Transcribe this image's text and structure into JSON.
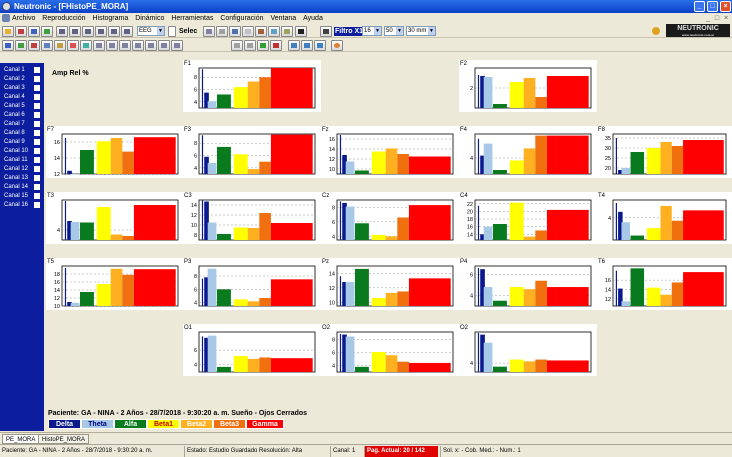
{
  "window": {
    "title": "Neutronic - [FHistoPE_MORA]",
    "minimize": "_",
    "maximize": "□",
    "close": "×"
  },
  "menu": [
    "Archivo",
    "Reproducción",
    "Histograma",
    "Dinámico",
    "Herramientas",
    "Configuración",
    "Ventana",
    "Ayuda"
  ],
  "toolbar": {
    "mode": "EEG",
    "selec_label": "Selec",
    "filter_label": "Filtro X1",
    "filter_value": "16",
    "speed_value": "50",
    "speed_unit": "30 mm",
    "brand": "NEUTRONIC",
    "brand_url": "www.neutronic.com.ar"
  },
  "channels": [
    "Canal 1",
    "Canal 2",
    "Canal 3",
    "Canal 4",
    "Canal 5",
    "Canal 6",
    "Canal 7",
    "Canal 8",
    "Canal 9",
    "Canal 10",
    "Canal 11",
    "Canal 12",
    "Canal 13",
    "Canal 14",
    "Canal 15",
    "Canal 16"
  ],
  "amp_title": "Amp Rel %",
  "patient": "Paciente: GA - NINA - 2 Años - 28/7/2018 - 9:30:20 a. m.  Sueño - Ojos Cerrados",
  "bands": [
    {
      "name": "Delta",
      "color": "#0a1a8c",
      "text": "#ffffff"
    },
    {
      "name": "Theta",
      "color": "#a8c8e8",
      "text": "#000080"
    },
    {
      "name": "Alfa",
      "color": "#0a7a1e",
      "text": "#ffffff"
    },
    {
      "name": "Beta1",
      "color": "#ffff00",
      "text": "#c00000"
    },
    {
      "name": "Beta2",
      "color": "#ffb020",
      "text": "#ffffff"
    },
    {
      "name": "Beta3",
      "color": "#f07010",
      "text": "#ffffff"
    },
    {
      "name": "Gamma",
      "color": "#ff0000",
      "text": "#ffffff"
    }
  ],
  "charts": [
    {
      "label": "F1",
      "ticks": [
        "8",
        "6",
        "4"
      ],
      "ylim": [
        3,
        9.5
      ],
      "values": [
        5.5,
        4.1,
        5.2,
        6.4,
        7.3,
        8.0,
        9.5
      ],
      "band0_line": 9.3
    },
    {
      "label": "F2",
      "ticks": [
        "2"
      ],
      "ylim": [
        0,
        4
      ],
      "values": [
        3.2,
        3.1,
        0.4,
        2.6,
        3.0,
        1.1,
        3.2
      ],
      "band0_line": 3.3
    },
    {
      "label": "F7",
      "ticks": [
        "16",
        "14",
        "12"
      ],
      "ylim": [
        12,
        17
      ],
      "values": [
        12.4,
        12.0,
        15.0,
        16.1,
        16.5,
        14.8,
        16.6
      ],
      "band0_line": 16.5
    },
    {
      "label": "F3",
      "ticks": [
        "8",
        "6",
        "4"
      ],
      "ylim": [
        3,
        9.5
      ],
      "values": [
        5.8,
        4.8,
        7.4,
        6.2,
        3.8,
        5.0,
        9.4
      ],
      "band0_line": 9.3
    },
    {
      "label": "Fz",
      "ticks": [
        "16",
        "14",
        "12",
        "10"
      ],
      "ylim": [
        9,
        17
      ],
      "values": [
        12.8,
        11.5,
        9.7,
        13.5,
        14.1,
        13.0,
        12.5
      ],
      "band0_line": 16.8
    },
    {
      "label": "F4",
      "ticks": [
        "4"
      ],
      "ylim": [
        2,
        7
      ],
      "values": [
        4.3,
        5.8,
        2.5,
        3.7,
        5.2,
        6.8,
        6.8
      ],
      "band0_line": 6.4
    },
    {
      "label": "F8",
      "ticks": [
        "35",
        "30",
        "25",
        "20"
      ],
      "ylim": [
        17,
        37
      ],
      "values": [
        19,
        20,
        28,
        30,
        33,
        31,
        34
      ],
      "band0_line": 35
    },
    {
      "label": "T3",
      "ticks": [
        "4"
      ],
      "ylim": [
        2,
        10
      ],
      "values": [
        5.8,
        5.6,
        5.5,
        8.6,
        3.1,
        2.8,
        9.0
      ],
      "band0_line": 9.8
    },
    {
      "label": "C3",
      "ticks": [
        "14",
        "12",
        "10",
        "8"
      ],
      "ylim": [
        7,
        15
      ],
      "values": [
        14.7,
        10.5,
        8.2,
        9.5,
        9.4,
        12.4,
        10.4
      ],
      "band0_line": 14.9
    },
    {
      "label": "Cz",
      "ticks": [
        "8",
        "6",
        "4"
      ],
      "ylim": [
        3.5,
        9
      ],
      "values": [
        8.6,
        8.1,
        5.8,
        4.2,
        4.0,
        6.6,
        8.3
      ],
      "band0_line": 8.8
    },
    {
      "label": "C4",
      "ticks": [
        "22",
        "20",
        "18",
        "16",
        "14"
      ],
      "ylim": [
        12.5,
        23
      ],
      "values": [
        14.0,
        16.0,
        16.7,
        22.3,
        13.4,
        15.0,
        20.4
      ],
      "band0_line": 21.5
    },
    {
      "label": "T4",
      "ticks": [
        "4"
      ],
      "ylim": [
        2.5,
        5.2
      ],
      "values": [
        4.4,
        3.7,
        2.8,
        3.3,
        4.8,
        3.8,
        4.5
      ],
      "band0_line": 5.0
    },
    {
      "label": "T5",
      "ticks": [
        "18",
        "16",
        "14",
        "12",
        "10"
      ],
      "ylim": [
        10,
        20
      ],
      "values": [
        11,
        10.8,
        13.5,
        15.5,
        19.3,
        17.8,
        19.2
      ],
      "band0_line": 19.5
    },
    {
      "label": "P3",
      "ticks": [
        "8",
        "6",
        "4"
      ],
      "ylim": [
        3.5,
        9.5
      ],
      "values": [
        7.8,
        9.1,
        6.0,
        4.5,
        4.2,
        4.7,
        7.5
      ],
      "band0_line": 7.6
    },
    {
      "label": "Pz",
      "ticks": [
        "14",
        "12",
        "10"
      ],
      "ylim": [
        9.5,
        15
      ],
      "values": [
        12.8,
        12.8,
        14.6,
        10.6,
        11.3,
        11.5,
        13.3
      ],
      "band0_line": 13.6
    },
    {
      "label": "P4",
      "ticks": [
        "6",
        "4"
      ],
      "ylim": [
        3,
        6.8
      ],
      "values": [
        6.5,
        4.8,
        3.5,
        4.8,
        4.6,
        5.4,
        4.8
      ],
      "band0_line": 6.6
    },
    {
      "label": "T6",
      "ticks": [
        "16",
        "14",
        "12"
      ],
      "ylim": [
        10.5,
        19
      ],
      "values": [
        14.2,
        11.5,
        18.5,
        14.4,
        12.9,
        15.5,
        17.7
      ],
      "band0_line": 18.0
    },
    {
      "label": "O1",
      "ticks": [
        "6",
        "4"
      ],
      "ylim": [
        3,
        8.5
      ],
      "values": [
        7.7,
        8.0,
        3.7,
        5.2,
        4.8,
        5.0,
        4.9
      ],
      "band0_line": 7.9
    },
    {
      "label": "O2",
      "ticks": [
        "8",
        "6",
        "4"
      ],
      "ylim": [
        3,
        9.2
      ],
      "values": [
        8.8,
        8.5,
        3.8,
        6.1,
        5.6,
        4.6,
        4.4
      ],
      "band0_line": 8.9
    },
    {
      "label": "O2",
      "ticks": [
        "4"
      ],
      "ylim": [
        3,
        7.5
      ],
      "values": [
        7.2,
        6.3,
        3.6,
        4.4,
        4.2,
        4.4,
        4.3
      ],
      "band0_line": 7.4
    }
  ],
  "doc_tabs": [
    "PE_MORA",
    "HistoPE_MORA"
  ],
  "status": {
    "patient": "Paciente: GA - NINA - 2 Años - 28/7/2018 - 9:30:20 a. m.",
    "estado": "Estado: Estudio Guardado  Resolución: Alta",
    "canal": "Canal: 1",
    "pag": "Pag. Actual: 20 / 142",
    "sol": "Sol. x:  - Cob. Med.: - Num.: 1"
  }
}
